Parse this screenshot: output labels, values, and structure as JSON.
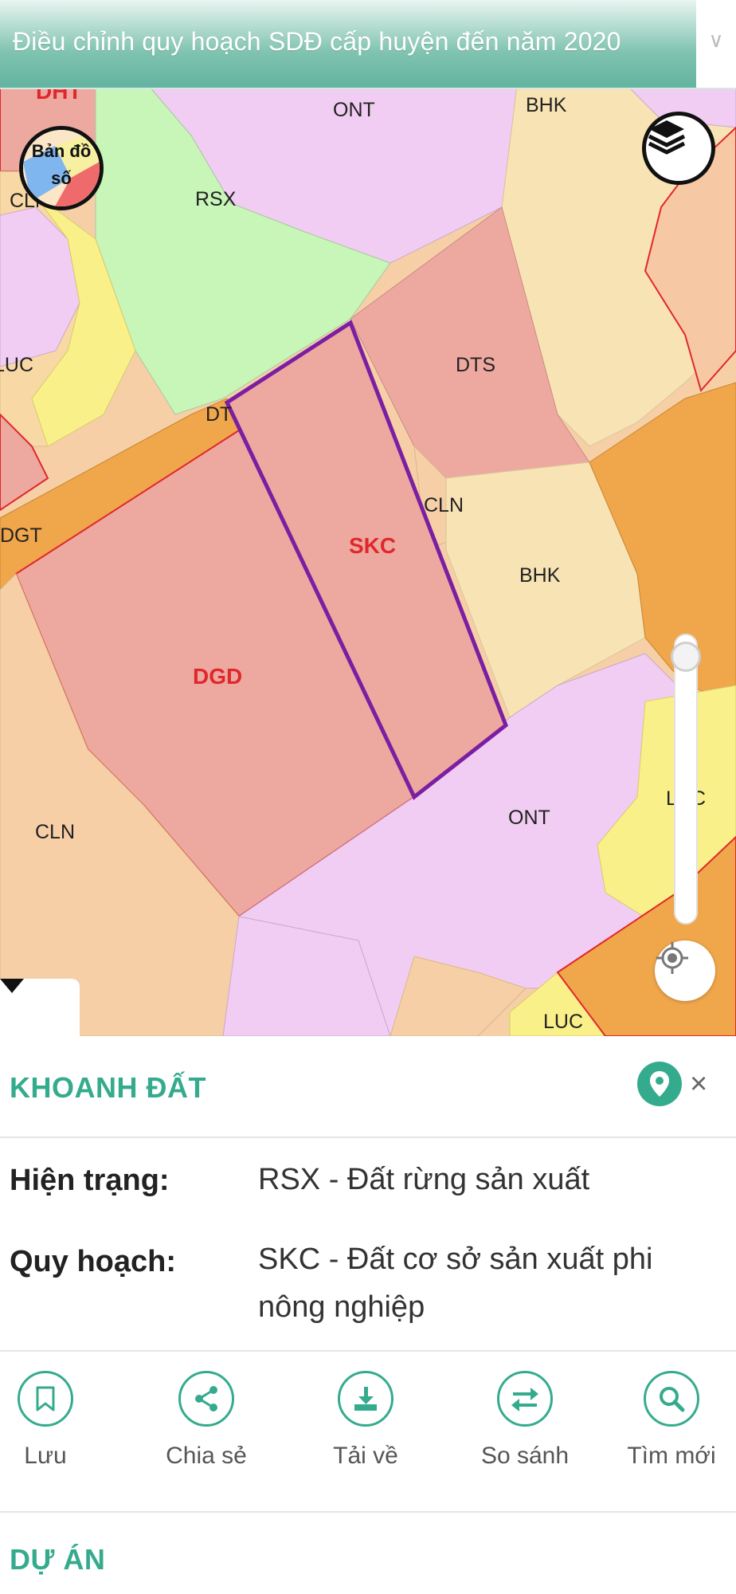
{
  "header": {
    "title": "Điều chỉnh quy hoạch SDĐ cấp huyện đến năm 2020",
    "dropdown_icon": "chevron-down-icon"
  },
  "map": {
    "basemap_button_label": "Bản đồ số",
    "zone_labels": {
      "dht": "DHT",
      "ont_top": "ONT",
      "bhk_top": "BHK",
      "rsx": "RSX",
      "cln_left_top": "CLN",
      "luc_left": "LUC",
      "dts": "DTS",
      "dt": "DT",
      "cln_mid": "CLN",
      "dgt": "DGT",
      "skc": "SKC",
      "bhk_mid": "BHK",
      "dgd": "DGD",
      "luc_right": "LUC",
      "ont_bottom": "ONT",
      "cln_bottom": "CLN",
      "luc_bottom": "LUC"
    },
    "zoom_level": 0.97,
    "colors": {
      "selected_outline": "#7b1fa2",
      "accent": "#35ab8e"
    }
  },
  "parcel": {
    "section_title": "KHOANH ĐẤT",
    "current_label": "Hiện trạng:",
    "current_value": "RSX - Đất rừng sản xuất",
    "planned_label": "Quy hoạch:",
    "planned_value": "SKC - Đất cơ sở sản xuất phi nông nghiệp"
  },
  "actions": [
    {
      "label": "Lưu",
      "icon": "bookmark-icon"
    },
    {
      "label": "Chia sẻ",
      "icon": "share-icon"
    },
    {
      "label": "Tải về",
      "icon": "download-icon"
    },
    {
      "label": "So sánh",
      "icon": "compare-icon"
    },
    {
      "label": "Tìm mới",
      "icon": "search-icon"
    }
  ],
  "project": {
    "section_title": "DỰ ÁN"
  }
}
